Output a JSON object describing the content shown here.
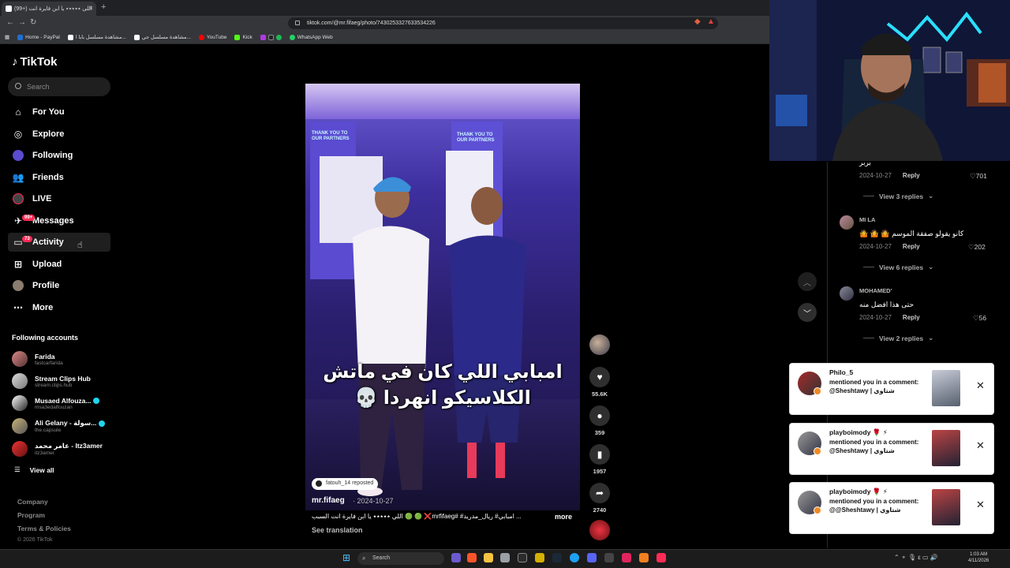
{
  "browser": {
    "tab_title": "(99+) اللی ٭٭٭٭٭ یا ابن فایرة انت",
    "url": "tiktok.com/@mr.fifaeg/photo/7430253327633534226",
    "bookmarks": [
      "Home - PayPal",
      "مشاهدة مسلسل بابا ا...",
      "مشاهدة مسلسل جي...",
      "YouTube",
      "Kick",
      "WhatsApp Web"
    ]
  },
  "sidebar": {
    "logo": "TikTok",
    "search_placeholder": "Search",
    "nav": [
      {
        "label": "For You",
        "icon": "home-icon"
      },
      {
        "label": "Explore",
        "icon": "compass-icon"
      },
      {
        "label": "Following",
        "icon": "following-icon"
      },
      {
        "label": "Friends",
        "icon": "friends-icon"
      },
      {
        "label": "LIVE",
        "icon": "live-icon"
      },
      {
        "label": "Messages",
        "icon": "messages-icon",
        "badge": "99+"
      },
      {
        "label": "Activity",
        "icon": "activity-icon",
        "badge": "73"
      },
      {
        "label": "Upload",
        "icon": "upload-icon"
      },
      {
        "label": "Profile",
        "icon": "profile-icon"
      },
      {
        "label": "More",
        "icon": "more-icon"
      }
    ],
    "following_title": "Following accounts",
    "accounts": [
      {
        "name": "Farida",
        "handle": "fastcarfarida",
        "verified": false
      },
      {
        "name": "Stream Clips Hub",
        "handle": "stream.clips.hub",
        "verified": false
      },
      {
        "name": "Musaed Alfouza...",
        "handle": "msa3edalfouzan",
        "verified": true
      },
      {
        "name": "Ali Gelany - سولة...",
        "handle": "the.capsule",
        "verified": true
      },
      {
        "name": "عامر محمد - Itz3amer",
        "handle": "itz3amer",
        "verified": false
      }
    ],
    "view_all": "View all",
    "footer": [
      "Company",
      "Program",
      "Terms & Policies"
    ],
    "copyright": "© 2026 TikTok"
  },
  "video": {
    "caption_line1": "امبابي اللي كان في ماتش",
    "caption_line2": "الكلاسيكو انهردا 💀",
    "repost": "fatouh_14 reposted",
    "author": "mr.fifaeg",
    "date": "· 2024-10-27",
    "description": "... امبابي# ريال_مدريد# #mrfifaeg❌ 🟢 🟢 اللي ٭٭٭٭٭ یا ابن فایرة انت السبب",
    "more": "more",
    "see_translation": "See translation",
    "poster_text_left": "THANK YOU TO OUR PARTNERS",
    "poster_text_right": "THANK YOU TO OUR PARTNERS"
  },
  "actions": {
    "likes": "55.6K",
    "comments": "359",
    "saves": "1957",
    "shares": "2740"
  },
  "comments": [
    {
      "name": "",
      "text": "بربر",
      "date": "2024-10-27",
      "reply": "Reply",
      "likes": "701",
      "view_replies": "View 3 replies"
    },
    {
      "name": "MI LA",
      "text": "كانو يقولو صفقة الموسم 🤷 🤷 🤷",
      "date": "2024-10-27",
      "reply": "Reply",
      "likes": "202",
      "view_replies": "View 6 replies"
    },
    {
      "name": "MOHAMED'",
      "text": "حتى هذا افضل منه",
      "date": "2024-10-27",
      "reply": "Reply",
      "likes": "56",
      "view_replies": "View 2 replies"
    }
  ],
  "notifications": [
    {
      "user": "Philo_5",
      "message": "mentioned you in a comment: @Sheshtawy | شتاوي"
    },
    {
      "user": "playboimody 🌹 ⚡",
      "message": "mentioned you in a comment: @Sheshtawy | شتاوي"
    },
    {
      "user": "playboimody 🌹 ⚡",
      "message": "mentioned you in a comment: @@Sheshtawy | شتاوي"
    }
  ],
  "taskbar": {
    "search": "Search",
    "time": "1:03 AM",
    "date": "4/11/2026"
  },
  "colors": {
    "accent": "#fe2c55",
    "verified": "#20d5ec",
    "background": "#000000"
  }
}
